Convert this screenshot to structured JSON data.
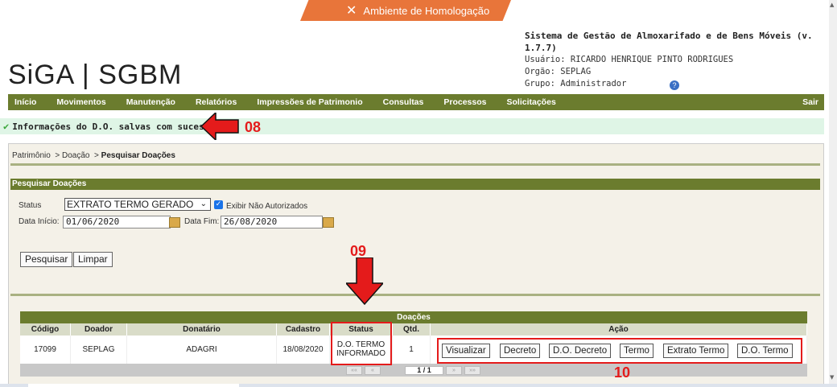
{
  "banner": {
    "label": "Ambiente de Homologação",
    "color": "#e8753a"
  },
  "logo": {
    "text": "SiGA | SGBM"
  },
  "system": {
    "title": "Sistema de Gestão de Almoxarifado e de Bens Móveis (v. 1.7.7)",
    "user": "Usuário: RICARDO HENRIQUE PINTO RODRIGUES",
    "org": "Orgão: SEPLAG",
    "group": "Grupo: Administrador"
  },
  "nav": {
    "items": [
      "Início",
      "Movimentos",
      "Manutenção",
      "Relatórios",
      "Impressões de Patrimonio",
      "Consultas",
      "Processos",
      "Solicitações"
    ],
    "logout": "Sair",
    "color": "#6b7c2e"
  },
  "message": {
    "text": "Informações do D.O. salvas com sucesso."
  },
  "annotations": {
    "a08": "08",
    "a09": "09",
    "a10": "10",
    "color": "#e41b1b"
  },
  "breadcrumb": {
    "p1": "Patrimônio",
    "p2": "Doação",
    "p3": "Pesquisar Doações",
    "sep": ">"
  },
  "search": {
    "title": "Pesquisar Doações",
    "status_label": "Status",
    "status_value": "EXTRATO TERMO GERADO",
    "checkbox_label": "Exibir Não Autorizados",
    "start_label": "Data Início:",
    "start_value": "01/06/2020",
    "end_label": "Data Fim:",
    "end_value": "26/08/2020",
    "search_button": "Pesquisar",
    "clear_button": "Limpar"
  },
  "grid": {
    "caption": "Doações",
    "headers": {
      "code": "Código",
      "donor": "Doador",
      "recipient": "Donatário",
      "created": "Cadastro",
      "status": "Status",
      "qty": "Qtd. Bens",
      "action": "Ação"
    },
    "rows": [
      {
        "code": "17099",
        "donor": "SEPLAG",
        "recipient": "ADAGRI",
        "created": "18/08/2020",
        "status_l1": "D.O. TERMO",
        "status_l2": "INFORMADO",
        "qty": "1"
      }
    ],
    "actions": [
      "Visualizar",
      "Decreto",
      "D.O. Decreto",
      "Termo",
      "Extrato Termo",
      "D.O. Termo"
    ],
    "pager": {
      "first": "««",
      "prev": "«",
      "page": "1 / 1",
      "next": "»",
      "last": "»»"
    }
  }
}
